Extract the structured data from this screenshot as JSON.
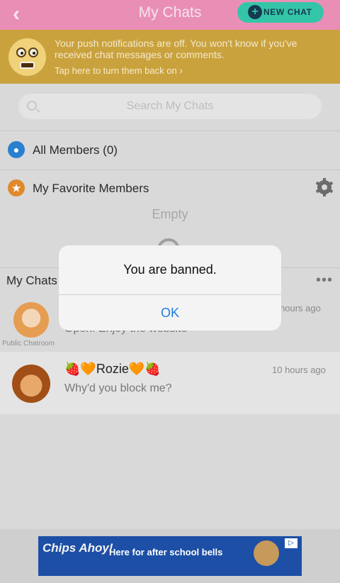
{
  "header": {
    "title": "My Chats",
    "back_icon": "chevron-left-icon",
    "new_chat_label": "NEW CHAT",
    "new_chat_icon": "plus-icon",
    "colors": {
      "header_bg": "#e98fb6",
      "button_bg": "#34c5a8"
    }
  },
  "banner": {
    "message": "Your push notifications are off. You won't know if you've received chat messages or comments.",
    "action": "Tap here to turn them back on ›",
    "icon": "shocked-face-icon"
  },
  "search": {
    "placeholder": "Search My Chats",
    "icon": "search-icon"
  },
  "members": {
    "all_label": "All Members (0)",
    "favorites_label": "My Favorite Members",
    "favorites_empty": "Empty",
    "settings_icon": "gear-icon"
  },
  "chats": {
    "section_title": "My Chats",
    "more_icon": "more-dots-icon",
    "items": [
      {
        "label": "Public Chatroom",
        "time": "hours ago",
        "preview": "Open! Enjoy the website"
      },
      {
        "name": "🍓🧡Rozie🧡🍓",
        "time": "10 hours ago",
        "preview": "Why'd you block me?"
      }
    ]
  },
  "dialog": {
    "message": "You are banned.",
    "ok_label": "OK"
  },
  "ad": {
    "logo": "Chips Ahoy!",
    "text": "Here for after school bells",
    "badge_icon": "adchoices-icon"
  }
}
